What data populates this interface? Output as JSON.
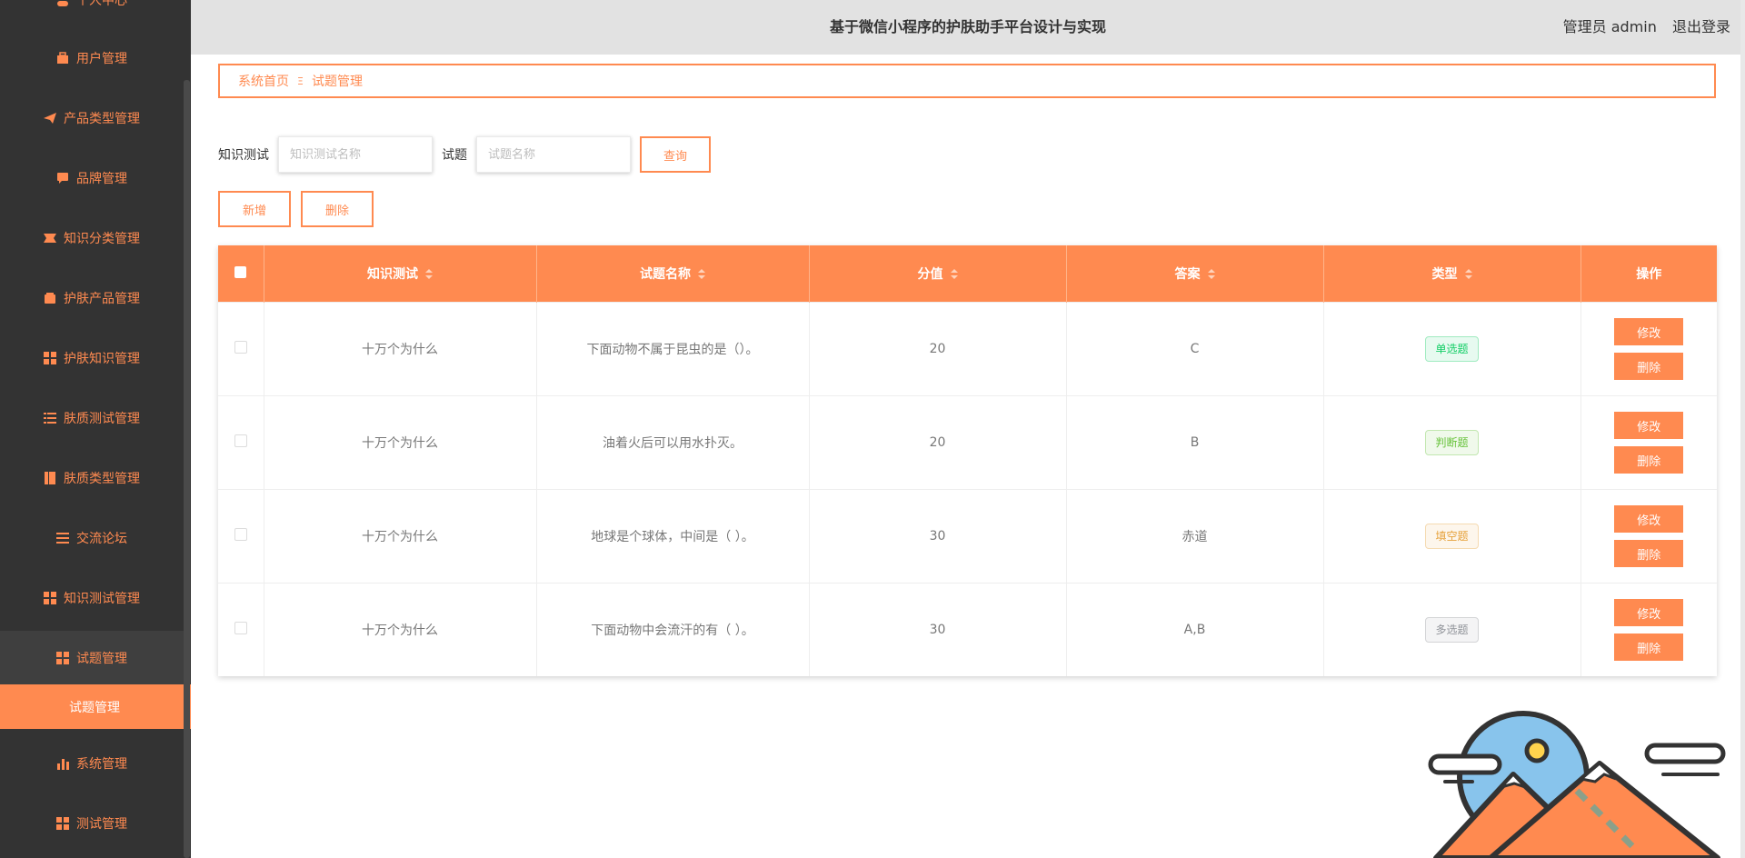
{
  "header": {
    "title": "基于微信小程序的护肤助手平台设计与实现",
    "user": "管理员 admin",
    "logout": "退出登录"
  },
  "sidebar": {
    "items": [
      {
        "label": "个人中心",
        "icon": "user-icon"
      },
      {
        "label": "用户管理",
        "icon": "briefcase-icon"
      },
      {
        "label": "产品类型管理",
        "icon": "paper-plane-icon"
      },
      {
        "label": "品牌管理",
        "icon": "chat-icon"
      },
      {
        "label": "知识分类管理",
        "icon": "ticket-icon"
      },
      {
        "label": "护肤产品管理",
        "icon": "wallet-icon"
      },
      {
        "label": "护肤知识管理",
        "icon": "grid-icon"
      },
      {
        "label": "肤质测试管理",
        "icon": "list-icon"
      },
      {
        "label": "肤质类型管理",
        "icon": "book-icon"
      },
      {
        "label": "交流论坛",
        "icon": "menu-icon"
      },
      {
        "label": "知识测试管理",
        "icon": "grid-icon"
      },
      {
        "label": "试题管理",
        "icon": "grid-icon"
      },
      {
        "label": "试题管理",
        "icon": ""
      },
      {
        "label": "系统管理",
        "icon": "bar-chart-icon"
      },
      {
        "label": "测试管理",
        "icon": "grid-icon"
      }
    ]
  },
  "breadcrumb": {
    "home": "系统首页",
    "separator": "Ξ",
    "current": "试题管理"
  },
  "search": {
    "label1": "知识测试",
    "placeholder1": "知识测试名称",
    "label2": "试题",
    "placeholder2": "试题名称",
    "query": "查询"
  },
  "actions": {
    "add": "新增",
    "delete": "删除"
  },
  "table": {
    "columns": [
      "知识测试",
      "试题名称",
      "分值",
      "答案",
      "类型",
      "操作"
    ],
    "rows": [
      {
        "test": "十万个为什么",
        "question": "下面动物不属于昆虫的是（）。",
        "score": "20",
        "answer": "C",
        "type": "单选题",
        "edit": "修改",
        "delete": "删除"
      },
      {
        "test": "十万个为什么",
        "question": "油着火后可以用水扑灭。",
        "score": "20",
        "answer": "B",
        "type": "判断题",
        "edit": "修改",
        "delete": "删除"
      },
      {
        "test": "十万个为什么",
        "question": "地球是个球体，中间是（ ）。",
        "score": "30",
        "answer": "赤道",
        "type": "填空题",
        "edit": "修改",
        "delete": "删除"
      },
      {
        "test": "十万个为什么",
        "question": "下面动物中会流汗的有（ ）。",
        "score": "30",
        "answer": "A,B",
        "type": "多选题",
        "edit": "修改",
        "delete": "删除"
      }
    ]
  },
  "colors": {
    "accent": "#ff8a50",
    "sidebar_bg": "#333333",
    "header_bg": "#e2e2e2"
  }
}
